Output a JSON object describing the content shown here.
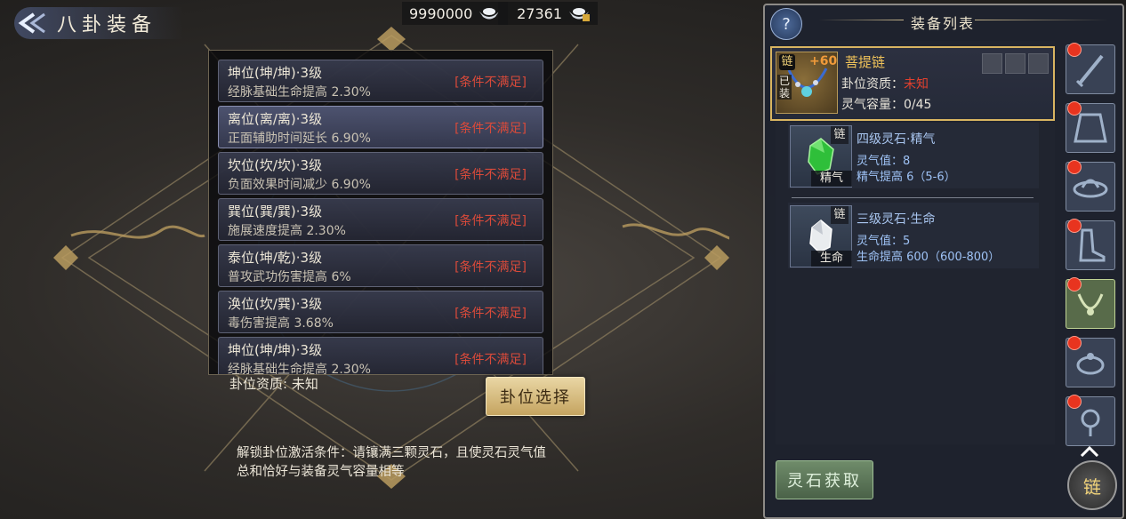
{
  "header": {
    "title": "八卦装备"
  },
  "currency": [
    {
      "value": "9990000",
      "icon": "silver-ingot-icon"
    },
    {
      "value": "27361",
      "icon": "silver-ingot-lock-icon"
    }
  ],
  "hexagrams": [
    {
      "name": "坤位(坤/坤)·3级",
      "effect": "经脉基础生命提高  2.30%",
      "status": "[条件不满足]"
    },
    {
      "name": "离位(离/离)·3级",
      "effect": "正面辅助时间延长  6.90%",
      "status": "[条件不满足]"
    },
    {
      "name": "坎位(坎/坎)·3级",
      "effect": "负面效果时间减少  6.90%",
      "status": "[条件不满足]"
    },
    {
      "name": "巽位(巽/巽)·3级",
      "effect": "施展速度提高  2.30%",
      "status": "[条件不满足]"
    },
    {
      "name": "泰位(坤/乾)·3级",
      "effect": "普攻武功伤害提高  6%",
      "status": "[条件不满足]"
    },
    {
      "name": "涣位(坎/巽)·3级",
      "effect": "毒伤害提高  3.68%",
      "status": "[条件不满足]"
    },
    {
      "name": "坤位(坤/坤)·3级",
      "effect": "经脉基础生命提高  2.30%",
      "status": "[条件不满足]"
    }
  ],
  "quality_label": "卦位资质: 未知",
  "select_button": "卦位选择",
  "unlock_hint": "解锁卦位激活条件：请镶满三颗灵石，且使灵石灵气值总和恰好与装备灵气容量相等",
  "panel": {
    "title": "装备列表",
    "help": "?",
    "equipment": {
      "name": "菩提链",
      "level": "+60",
      "equipped_tag": "已装",
      "icon_char": "链",
      "quality_label": "卦位资质：",
      "quality_value": "未知",
      "capacity": "灵气容量：0/45"
    },
    "stones": [
      {
        "name": "四级灵石·精气",
        "tag": "链",
        "label": "精气",
        "spirit": "灵气值：8",
        "effect": "精气提高  6（5-6）",
        "color": "#2fbf3a"
      },
      {
        "name": "三级灵石·生命",
        "tag": "链",
        "label": "生命",
        "spirit": "灵气值：5",
        "effect": "生命提高  600（600-800）",
        "color": "#e9ecef"
      }
    ],
    "get_button": "灵石获取",
    "chain_button": "链"
  }
}
